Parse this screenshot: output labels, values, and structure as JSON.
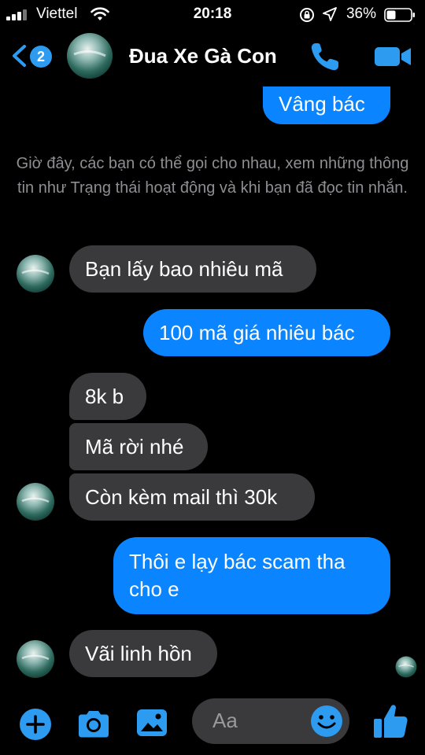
{
  "status_bar": {
    "carrier": "Viettel",
    "time": "20:18",
    "battery_percent": "36%"
  },
  "header": {
    "back_badge_count": "2",
    "title": "Đua Xe Gà Con",
    "icons": [
      "back-chevron-icon",
      "phone-icon",
      "video-camera-icon"
    ]
  },
  "messages": [
    {
      "from": "me",
      "text": "Vâng bác"
    },
    {
      "from": "system",
      "text": "Giờ đây, các bạn có thể gọi cho nhau, xem những thông tin như Trạng thái hoạt động và khi bạn đã đọc tin nhắn."
    },
    {
      "from": "them",
      "text": "Bạn lấy bao nhiêu mã"
    },
    {
      "from": "me",
      "text": "100 mã giá nhiêu bác"
    },
    {
      "from": "them",
      "text": "8k b"
    },
    {
      "from": "them",
      "text": "Mã rời nhé"
    },
    {
      "from": "them",
      "text": "Còn kèm mail thì 30k"
    },
    {
      "from": "me",
      "lines": [
        "Thôi e lạy bác scam tha",
        "cho e"
      ]
    },
    {
      "from": "them",
      "text": "Vãi linh hồn"
    }
  ],
  "composer": {
    "placeholder": "Aa",
    "icons": [
      "plus-icon",
      "camera-icon",
      "image-icon",
      "emoji-icon",
      "thumbs-up-icon"
    ]
  },
  "colors": {
    "background": "#000000",
    "accent": "#0a84ff",
    "incoming_bubble": "#3a3a3c",
    "system_text": "#8e8e93"
  }
}
